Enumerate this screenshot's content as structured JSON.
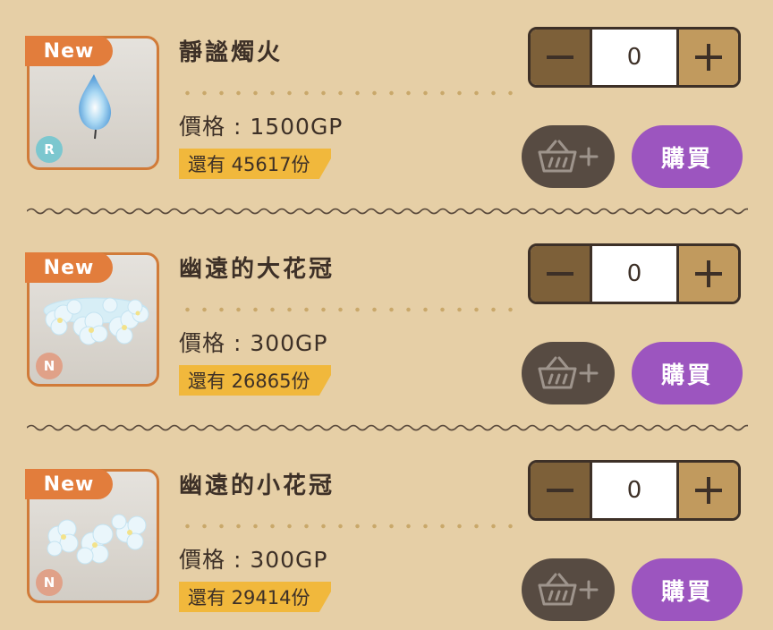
{
  "items": [
    {
      "badge": "New",
      "rarity": "R",
      "rarity_color": "#7cc7cf",
      "art": "blue-flame-icon",
      "name": "靜謐燭火",
      "price": "價格 : 1500GP",
      "stock": "還有 45617份",
      "quantity": "0",
      "buy_label": "購買"
    },
    {
      "badge": "New",
      "rarity": "N",
      "rarity_color": "#e0a188",
      "art": "large-flower-crown-icon",
      "name": "幽遠的大花冠",
      "price": "價格 : 300GP",
      "stock": "還有 26865份",
      "quantity": "0",
      "buy_label": "購買"
    },
    {
      "badge": "New",
      "rarity": "N",
      "rarity_color": "#e0a188",
      "art": "small-flower-crown-icon",
      "name": "幽遠的小花冠",
      "price": "價格 : 300GP",
      "stock": "還有 29414份",
      "quantity": "0",
      "buy_label": "購買"
    }
  ],
  "icons": {
    "minus": "minus-icon",
    "plus": "plus-icon",
    "cart": "basket-add-icon"
  },
  "colors": {
    "background": "#e6cfa6",
    "badge": "#e27d3c",
    "buy_button": "#9c55bf",
    "cart_button": "#574b42",
    "stock_tag": "#f1b83c",
    "text": "#3d3027"
  }
}
